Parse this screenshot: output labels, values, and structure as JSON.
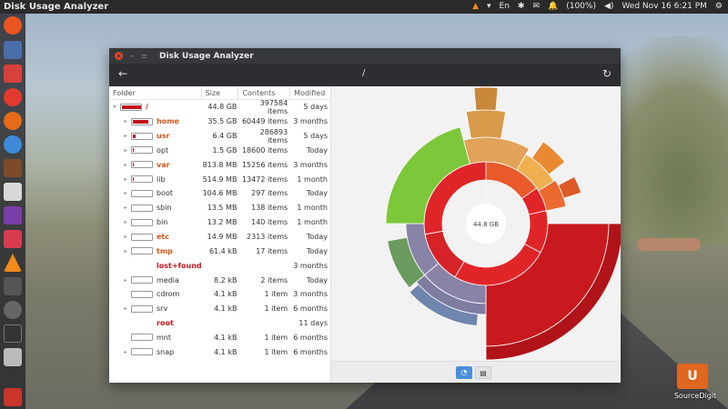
{
  "topbar": {
    "app_name": "Disk Usage Analyzer",
    "tray": {
      "keyboard": "En",
      "battery": "(100%)",
      "datetime": "Wed Nov 16  6:21 PM"
    }
  },
  "window": {
    "title": "Disk Usage Analyzer",
    "path": "/",
    "columns": {
      "folder": "Folder",
      "size": "Size",
      "contents": "Contents",
      "modified": "Modified"
    }
  },
  "rows": [
    {
      "name": "/",
      "size": "44.8 GB",
      "contents": "397584 items",
      "modified": "5 days",
      "style": "red",
      "bar": 1.0,
      "expanded": true
    },
    {
      "name": "home",
      "size": "35.5 GB",
      "contents": "60449 items",
      "modified": "3 months",
      "style": "hl",
      "bar": 0.79
    },
    {
      "name": "usr",
      "size": "6.4 GB",
      "contents": "286893 items",
      "modified": "5 days",
      "style": "hl",
      "bar": 0.14
    },
    {
      "name": "opt",
      "size": "1.5 GB",
      "contents": "18600 items",
      "modified": "Today",
      "style": "",
      "bar": 0.03
    },
    {
      "name": "var",
      "size": "813.8 MB",
      "contents": "15256 items",
      "modified": "3 months",
      "style": "hl",
      "bar": 0.02
    },
    {
      "name": "lib",
      "size": "514.9 MB",
      "contents": "13472 items",
      "modified": "1 month",
      "style": "",
      "bar": 0.01
    },
    {
      "name": "boot",
      "size": "104.6 MB",
      "contents": "297 items",
      "modified": "Today",
      "style": "",
      "bar": 0
    },
    {
      "name": "sbin",
      "size": "13.5 MB",
      "contents": "138 items",
      "modified": "1 month",
      "style": "",
      "bar": 0
    },
    {
      "name": "bin",
      "size": "13.2 MB",
      "contents": "140 items",
      "modified": "1 month",
      "style": "",
      "bar": 0
    },
    {
      "name": "etc",
      "size": "14.9 MB",
      "contents": "2313 items",
      "modified": "Today",
      "style": "hl",
      "bar": 0
    },
    {
      "name": "tmp",
      "size": "61.4 kB",
      "contents": "17 items",
      "modified": "Today",
      "style": "hl",
      "bar": 0
    },
    {
      "name": "lost+found",
      "size": "",
      "contents": "",
      "modified": "3 months",
      "style": "red",
      "nobar": true
    },
    {
      "name": "media",
      "size": "8.2 kB",
      "contents": "2 items",
      "modified": "Today",
      "style": "",
      "bar": 0
    },
    {
      "name": "cdrom",
      "size": "4.1 kB",
      "contents": "1 item",
      "modified": "3 months",
      "style": "",
      "bar": 0,
      "leaf": true
    },
    {
      "name": "srv",
      "size": "4.1 kB",
      "contents": "1 item",
      "modified": "6 months",
      "style": "",
      "bar": 0
    },
    {
      "name": "root",
      "size": "",
      "contents": "",
      "modified": "11 days",
      "style": "red",
      "nobar": true,
      "leaf": true
    },
    {
      "name": "mnt",
      "size": "4.1 kB",
      "contents": "1 item",
      "modified": "6 months",
      "style": "",
      "bar": 0,
      "leaf": true
    },
    {
      "name": "snap",
      "size": "4.1 kB",
      "contents": "1 item",
      "modified": "6 months",
      "style": "",
      "bar": 0
    }
  ],
  "chart": {
    "center_label": "44.8 GB"
  },
  "desktop_icon": {
    "label": "SourceDigit",
    "letter": "U"
  },
  "colors": {
    "accent": "#4a90d9",
    "highlight": "#d4561b",
    "root_red": "#c8141c"
  }
}
